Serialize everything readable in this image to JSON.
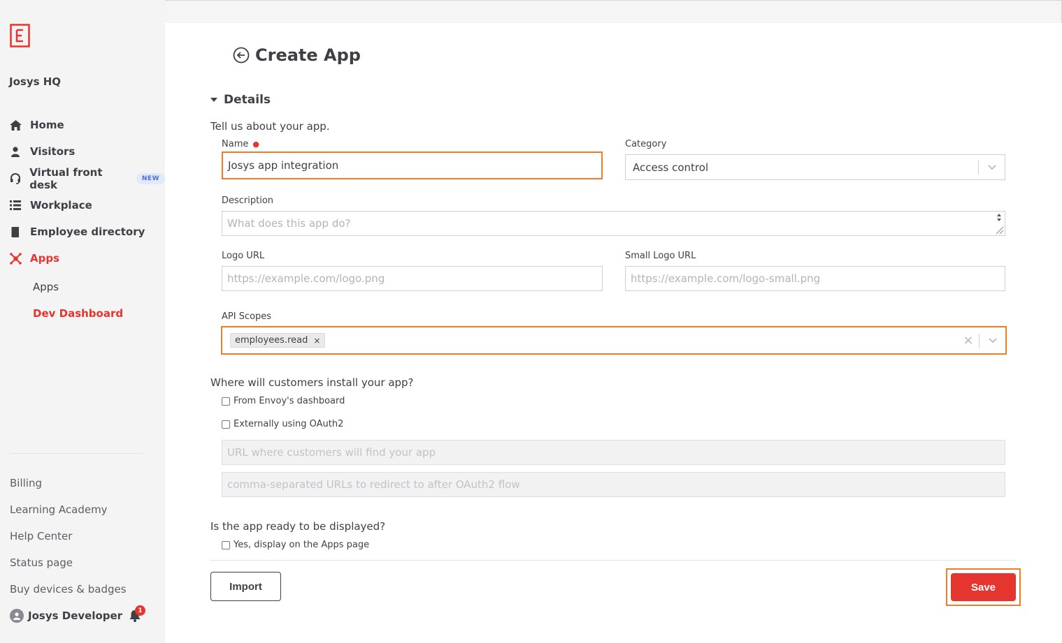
{
  "sidebar": {
    "company": "Josys HQ",
    "nav": [
      {
        "label": "Home",
        "icon": "home-icon"
      },
      {
        "label": "Visitors",
        "icon": "person-icon"
      },
      {
        "label": "Virtual front desk",
        "icon": "headset-icon",
        "badge": "NEW"
      },
      {
        "label": "Workplace",
        "icon": "list-icon"
      },
      {
        "label": "Employee directory",
        "icon": "book-icon"
      },
      {
        "label": "Apps",
        "icon": "apps-icon",
        "active": true
      }
    ],
    "sub": [
      {
        "label": "Apps"
      },
      {
        "label": "Dev Dashboard",
        "active": true
      }
    ],
    "links": [
      "Billing",
      "Learning Academy",
      "Help Center",
      "Status page",
      "Buy devices & badges"
    ],
    "user": "Josys Developer",
    "notifications": "1"
  },
  "page": {
    "title": "Create App",
    "section": "Details",
    "intro": "Tell us about your app.",
    "fields": {
      "name_label": "Name",
      "name_value": "Josys app integration",
      "category_label": "Category",
      "category_value": "Access control",
      "description_label": "Description",
      "description_placeholder": "What does this app do?",
      "logo_label": "Logo URL",
      "logo_placeholder": "https://example.com/logo.png",
      "small_logo_label": "Small Logo URL",
      "small_logo_placeholder": "https://example.com/logo-small.png",
      "scopes_label": "API Scopes",
      "scopes": [
        "employees.read"
      ]
    },
    "install": {
      "question": "Where will customers install your app?",
      "option1": "From Envoy's dashboard",
      "option2": "Externally using OAuth2",
      "url_placeholder": "URL where customers will find your app",
      "redirect_placeholder": "comma-separated URLs to redirect to after OAuth2 flow"
    },
    "display": {
      "question": "Is the app ready to be displayed?",
      "option": "Yes, display on the Apps page"
    },
    "buttons": {
      "import": "Import",
      "save": "Save"
    }
  },
  "colors": {
    "accent": "#e5352f",
    "highlight": "#f07d22"
  }
}
